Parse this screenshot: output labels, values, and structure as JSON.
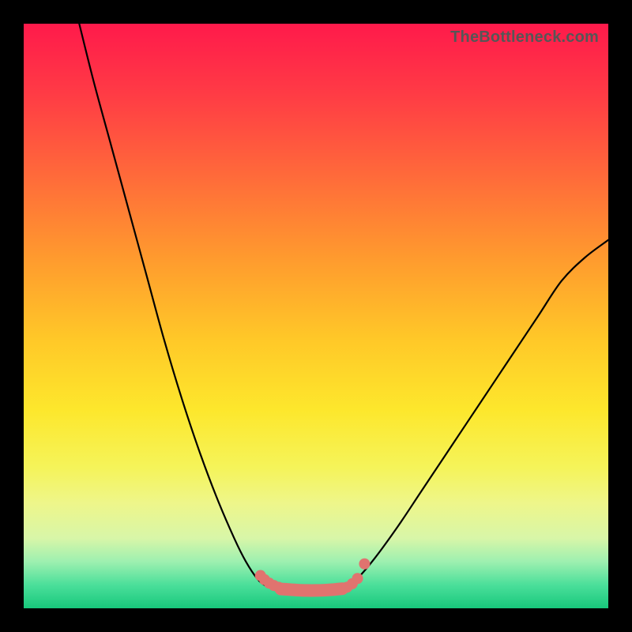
{
  "watermark": "TheBottleneck.com",
  "chart_data": {
    "type": "line",
    "title": "",
    "xlabel": "",
    "ylabel": "",
    "xlim": [
      0,
      100
    ],
    "ylim": [
      0,
      100
    ],
    "series": [
      {
        "name": "left-curve",
        "x": [
          9.5,
          12,
          15,
          18,
          21,
          24,
          27,
          30,
          33,
          36,
          38,
          40,
          41.5,
          43
        ],
        "values": [
          100,
          90,
          79,
          68,
          57,
          46,
          36,
          27,
          19,
          12,
          8,
          5,
          3.8,
          3.3
        ]
      },
      {
        "name": "bottom-flat",
        "x": [
          43,
          46,
          49,
          52,
          55
        ],
        "values": [
          3.3,
          3.1,
          3.0,
          3.1,
          3.4
        ]
      },
      {
        "name": "right-curve",
        "x": [
          55,
          57,
          60,
          64,
          68,
          72,
          76,
          80,
          84,
          88,
          92,
          96,
          100
        ],
        "values": [
          3.4,
          5.0,
          8.5,
          14,
          20,
          26,
          32,
          38,
          44,
          50,
          56,
          60,
          63
        ]
      },
      {
        "name": "highlight-left-dots",
        "x": [
          40.5,
          41.2,
          42.0,
          42.8,
          43.6
        ],
        "values": [
          5.6,
          4.9,
          4.3,
          3.9,
          3.6
        ]
      },
      {
        "name": "highlight-bottom-band",
        "x": [
          44,
          45.5,
          47,
          48.5,
          50,
          51.5,
          53,
          54.5
        ],
        "values": [
          3.3,
          3.2,
          3.1,
          3.05,
          3.05,
          3.1,
          3.2,
          3.35
        ]
      },
      {
        "name": "highlight-right-dots",
        "x": [
          55.3,
          56.2,
          57.1
        ],
        "values": [
          3.6,
          4.2,
          5.1
        ]
      },
      {
        "name": "highlight-outlier",
        "x": [
          58.3
        ],
        "values": [
          7.6
        ]
      }
    ]
  }
}
